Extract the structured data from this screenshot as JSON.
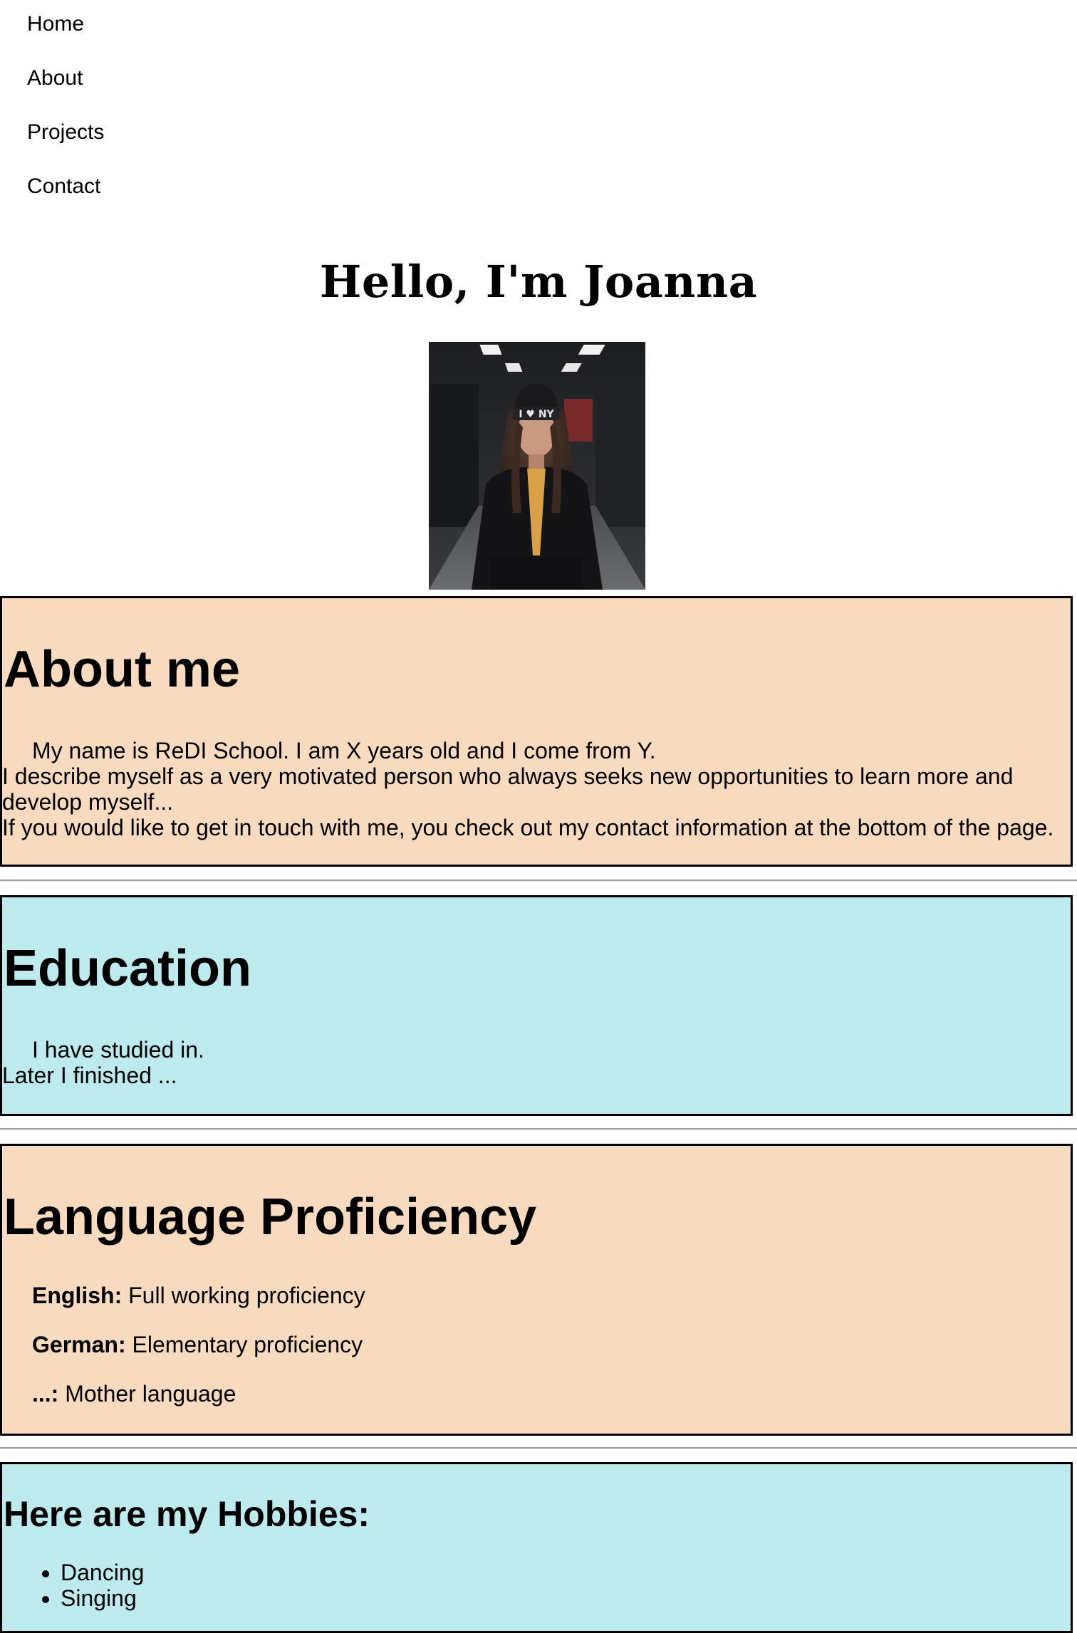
{
  "nav": {
    "items": [
      {
        "label": "Home"
      },
      {
        "label": "About"
      },
      {
        "label": "Projects"
      },
      {
        "label": "Contact"
      }
    ]
  },
  "hero": {
    "title": "Hello, I'm Joanna",
    "image_icon": "portrait-photo"
  },
  "about": {
    "title": "About me",
    "line1": "My name is ReDI School. I am X years old and I come from Y.",
    "line2": "I describe myself as a very motivated person who always seeks new opportunities to learn more and develop myself...",
    "line3": "If you would like to get in touch with me, you check out my contact information at the bottom of the page."
  },
  "education": {
    "title": "Education",
    "line1": "I have studied in.",
    "line2": "Later I finished ..."
  },
  "languages": {
    "title": "Language Proficiency",
    "items": [
      {
        "language": "English:",
        "level": " Full working proficiency"
      },
      {
        "language": "German:",
        "level": " Elementary proficiency"
      },
      {
        "language": "...:",
        "level": " Mother language"
      }
    ]
  },
  "hobbies": {
    "title": "Here are my Hobbies:",
    "items": [
      "Dancing",
      "Singing"
    ]
  },
  "colors": {
    "peach_section": "#f8dbbe",
    "teal_section": "#bdebed",
    "border": "#000000",
    "divider": "#9e9e9e"
  }
}
